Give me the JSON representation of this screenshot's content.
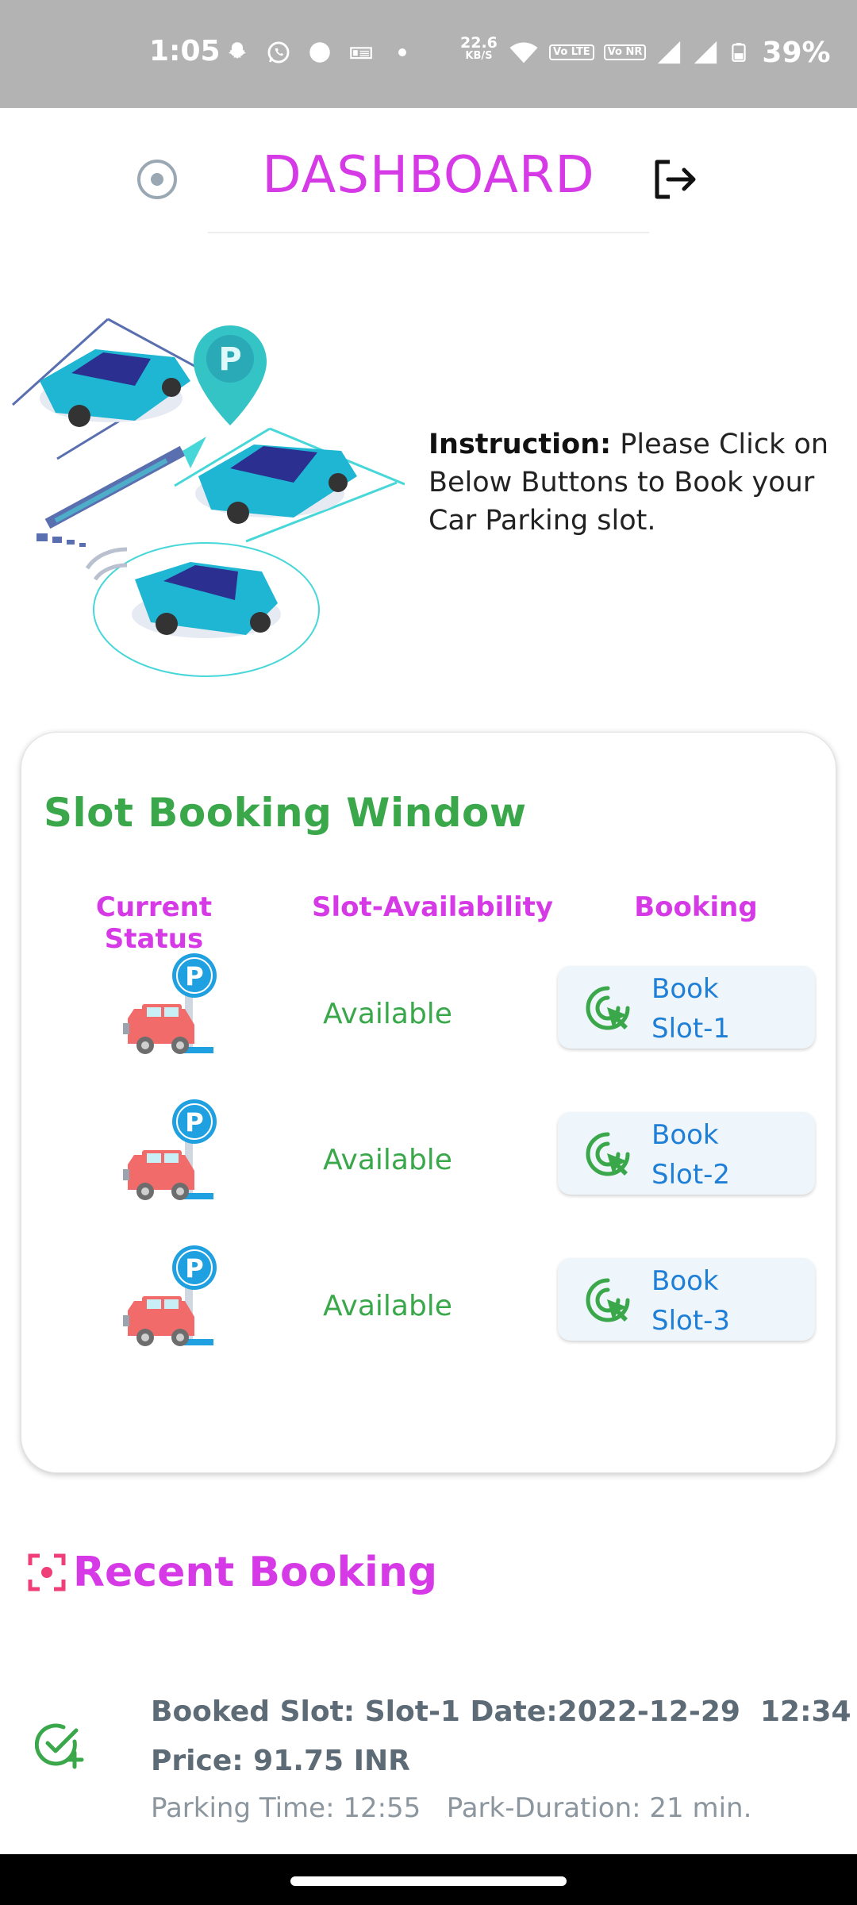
{
  "status_bar": {
    "time": "1:05",
    "speed_value": "22.6",
    "speed_unit": "KB/S",
    "sim1": "Vo LTE",
    "sim2": "Vo NR",
    "battery": "39%"
  },
  "header": {
    "title": "DASHBOARD",
    "left_icon": "radio-circle-icon",
    "right_icon": "logout-icon"
  },
  "instruction": {
    "label": "Instruction:",
    "text": "Please Click on Below Buttons to Book your Car Parking slot."
  },
  "slot_window": {
    "title": "Slot Booking Window",
    "columns": [
      "Current Status",
      "Slot-Availability",
      "Booking"
    ],
    "slots": [
      {
        "status_icon": "parking-car-icon",
        "availability": "Available",
        "book_line1": "Book",
        "book_line2": "Slot-1"
      },
      {
        "status_icon": "parking-car-icon",
        "availability": "Available",
        "book_line1": "Book",
        "book_line2": "Slot-2"
      },
      {
        "status_icon": "parking-car-icon",
        "availability": "Available",
        "book_line1": "Book",
        "book_line2": "Slot-3"
      }
    ]
  },
  "recent": {
    "title": "Recent Booking",
    "items": [
      {
        "line1": "Booked Slot: Slot-1 Date:2022-12-29  12:34",
        "line2": "Price: 91.75 INR",
        "line3": "Parking Time: 12:55   Park-Duration: 21 min."
      }
    ]
  },
  "colors": {
    "accent": "#d63ae6",
    "green": "#3aa84a",
    "blue": "#1f7fd6",
    "statusbar": "#b3b3b3"
  }
}
